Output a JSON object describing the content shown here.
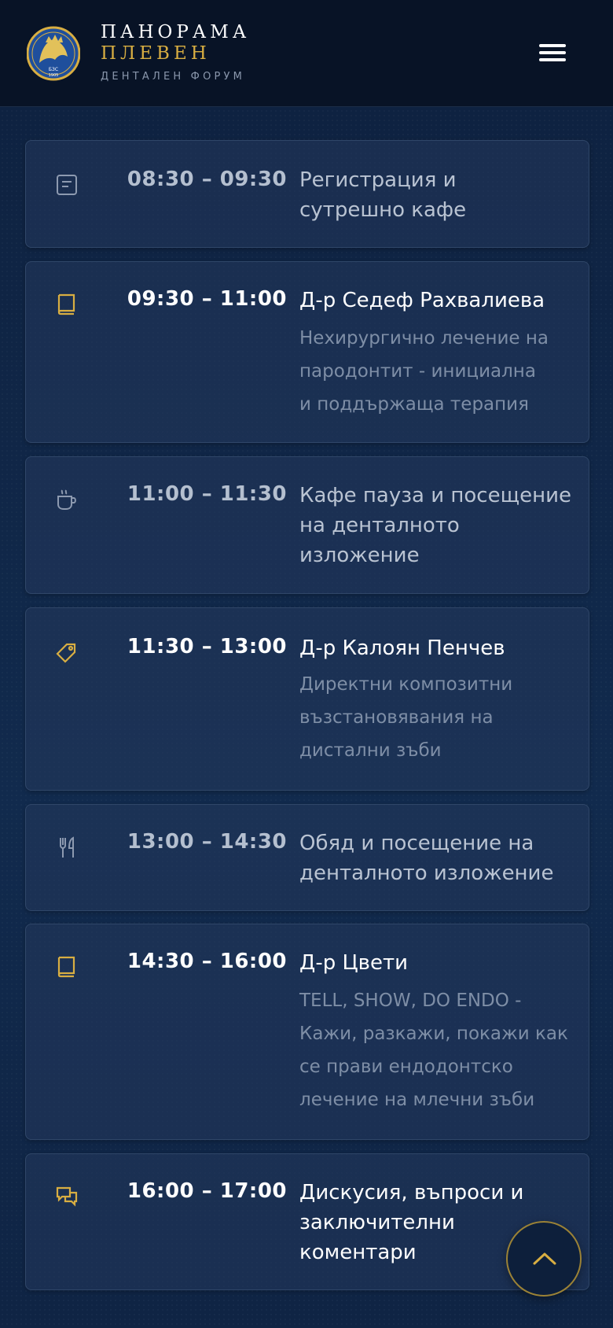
{
  "header": {
    "brand_line1": "ПАНОРАМА",
    "brand_line2": "ПЛЕВЕН",
    "brand_line3": "ДЕНТАЛЕН ФОРУМ",
    "logo_text": "БЗС",
    "logo_year": "1905",
    "menu_icon": "hamburger-menu-icon"
  },
  "colors": {
    "header_bg": "#081326",
    "page_bg": "#0f2444",
    "accent_gold": "#d8ae42",
    "muted_text": "#7e8ea6"
  },
  "schedule": [
    {
      "icon": "note-icon",
      "time": "08:30 – 09:30",
      "title_lines": [
        "Регистрация и",
        "сутрешно кафе"
      ],
      "desc_lines": []
    },
    {
      "icon": "book-icon",
      "time": "09:30 – 11:00",
      "title_lines": [
        "Д-р Седеф Рахвалиева"
      ],
      "desc_lines": [
        "Нехирургично лечение на",
        "пародонтит - инициална",
        "и поддържаща терапия"
      ]
    },
    {
      "icon": "coffee-icon",
      "time": "11:00 – 11:30",
      "title_lines": [
        "Кафе пауза и посещение",
        "на денталното",
        "изложение"
      ],
      "desc_lines": []
    },
    {
      "icon": "tag-icon",
      "time": "11:30 – 13:00",
      "title_lines": [
        "Д-р Калоян Пенчев"
      ],
      "desc_lines": [
        "Директни композитни",
        "възстановявания на",
        "дистални зъби"
      ]
    },
    {
      "icon": "cutlery-icon",
      "time": "13:00 – 14:30",
      "title_lines": [
        "Обяд и посещение на",
        "денталното изложение"
      ],
      "desc_lines": []
    },
    {
      "icon": "book-icon",
      "time": "14:30 – 16:00",
      "title_lines": [
        "Д-р Цвети"
      ],
      "desc_lines": [
        "TELL, SHOW, DO ENDO -",
        "Кажи, разкажи, покажи как",
        "се прави ендодонтско",
        "лечение на млечни зъби"
      ]
    },
    {
      "icon": "discussion-icon",
      "time": "16:00 – 17:00",
      "title_lines": [
        "Дискусия, въпроси и",
        "заключителни",
        "коментари"
      ],
      "desc_lines": []
    }
  ],
  "scroll_top": {
    "icon": "chevron-up-icon"
  }
}
